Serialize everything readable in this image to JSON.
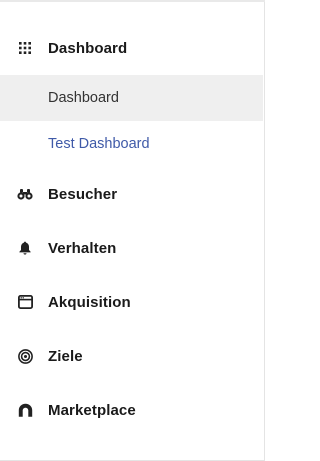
{
  "sidebar": {
    "sections": [
      {
        "label": "Dashboard",
        "icon": "grid-icon"
      },
      {
        "label": "Besucher",
        "icon": "binoculars-icon"
      },
      {
        "label": "Verhalten",
        "icon": "bell-icon"
      },
      {
        "label": "Akquisition",
        "icon": "browser-window-icon"
      },
      {
        "label": "Ziele",
        "icon": "target-icon"
      },
      {
        "label": "Marketplace",
        "icon": "marketplace-icon"
      }
    ],
    "dashboard_items": [
      {
        "label": "Dashboard",
        "active": true
      },
      {
        "label": "Test Dashboard",
        "active": false
      }
    ]
  },
  "colors": {
    "active_bg": "#efefef",
    "link": "#3f5aa8",
    "text": "#1a1a1a"
  }
}
